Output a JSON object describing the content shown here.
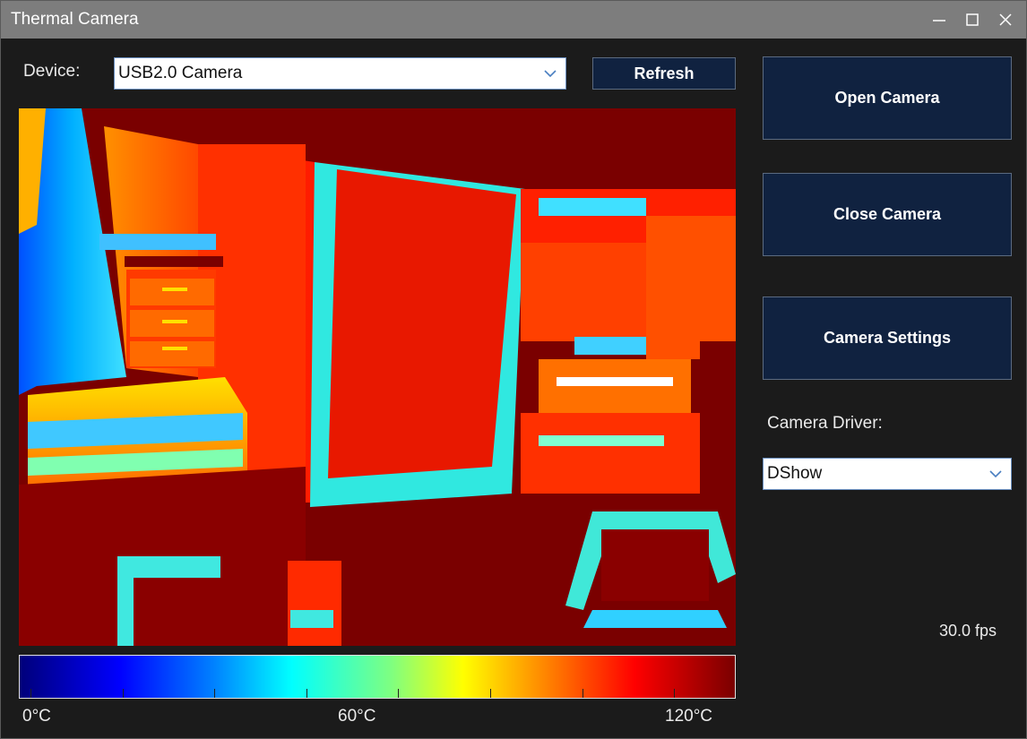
{
  "window": {
    "title": "Thermal Camera"
  },
  "controls": {
    "device_label": "Device:",
    "device_value": "USB2.0 Camera",
    "refresh_label": "Refresh",
    "open_label": "Open Camera",
    "close_label": "Close Camera",
    "settings_label": "Camera Settings",
    "driver_label": "Camera Driver:",
    "driver_value": "DShow",
    "fps": "30.0 fps"
  },
  "colorbar": {
    "min_label": "0°C",
    "mid_label": "60°C",
    "max_label": "120°C",
    "colormap": [
      "#00007a",
      "#0000ff",
      "#0080ff",
      "#00ffff",
      "#7fff80",
      "#ffff00",
      "#ff8000",
      "#ff0000",
      "#7a0000"
    ]
  },
  "colors": {
    "button_bg": "#102240",
    "titlebar_bg": "#7d7d7d",
    "window_bg": "#1b1b1b"
  }
}
